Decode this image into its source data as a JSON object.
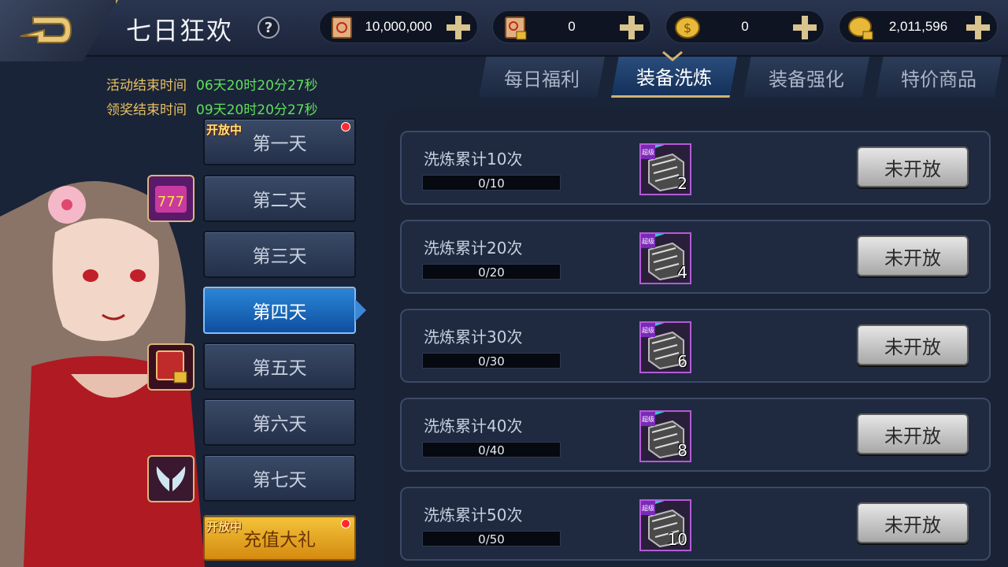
{
  "header": {
    "title": "七日狂欢",
    "help_label": "?"
  },
  "resources": [
    {
      "icon": "gold-scroll-icon",
      "value": "10,000,000"
    },
    {
      "icon": "locked-scroll-icon",
      "value": "0"
    },
    {
      "icon": "coin-icon",
      "value": "0"
    },
    {
      "icon": "locked-coin-icon",
      "value": "2,011,596"
    }
  ],
  "timers": {
    "activity_label": "活动结束时间",
    "activity_value": "06天20时20分27秒",
    "claim_label": "领奖结束时间",
    "claim_value": "09天20时20分27秒"
  },
  "days": [
    {
      "label": "第一天",
      "badge": "开放中",
      "dot": true
    },
    {
      "label": "第二天"
    },
    {
      "label": "第三天"
    },
    {
      "label": "第四天",
      "active": true
    },
    {
      "label": "第五天"
    },
    {
      "label": "第六天"
    },
    {
      "label": "第七天"
    },
    {
      "label": "充值大礼",
      "badge": "开放中",
      "dot": true
    }
  ],
  "tabs": [
    "每日福利",
    "装备洗炼",
    "装备强化",
    "特价商品"
  ],
  "active_tab": 1,
  "tasks": [
    {
      "title": "洗炼累计10次",
      "progress": "0/10",
      "fraction": 0,
      "reward_qty": "2",
      "reward_tag": "超级",
      "button": "未开放"
    },
    {
      "title": "洗炼累计20次",
      "progress": "0/20",
      "fraction": 0,
      "reward_qty": "4",
      "reward_tag": "超级",
      "button": "未开放"
    },
    {
      "title": "洗炼累计30次",
      "progress": "0/30",
      "fraction": 0,
      "reward_qty": "6",
      "reward_tag": "超级",
      "button": "未开放"
    },
    {
      "title": "洗炼累计40次",
      "progress": "0/40",
      "fraction": 0,
      "reward_qty": "8",
      "reward_tag": "超级",
      "button": "未开放"
    },
    {
      "title": "洗炼累计50次",
      "progress": "0/50",
      "fraction": 0,
      "reward_qty": "10",
      "reward_tag": "超级",
      "button": "未开放"
    }
  ],
  "colors": {
    "accent_gold": "#c9a45c",
    "timer_green": "#5ee05a",
    "timer_label": "#e8c062",
    "active_blue": "#2a86d8"
  }
}
